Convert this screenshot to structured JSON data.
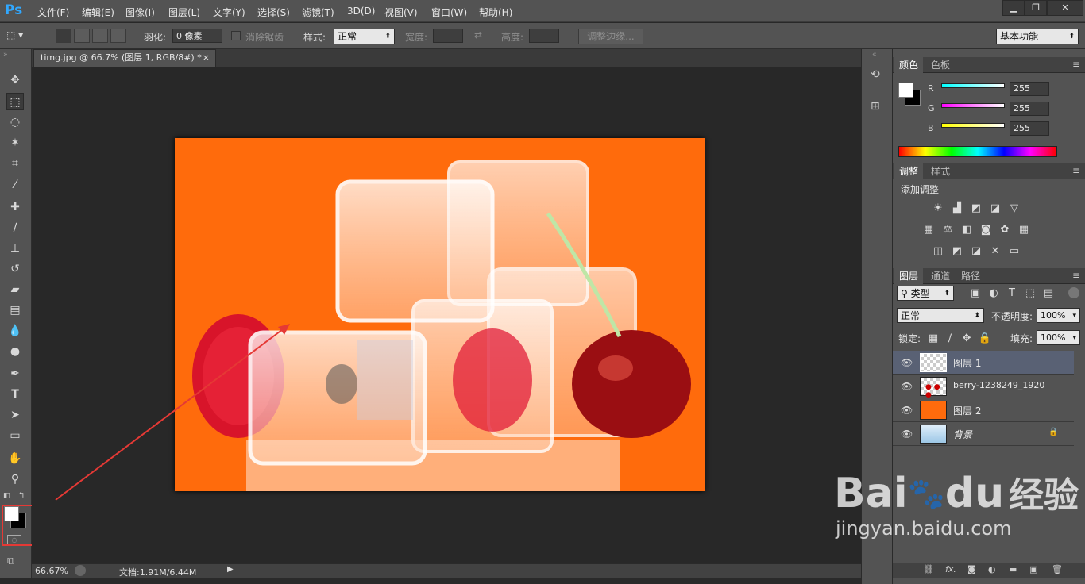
{
  "app": {
    "logo": "Ps"
  },
  "menu": [
    "文件(F)",
    "编辑(E)",
    "图像(I)",
    "图层(L)",
    "文字(Y)",
    "选择(S)",
    "滤镜(T)",
    "3D(D)",
    "视图(V)",
    "窗口(W)",
    "帮助(H)"
  ],
  "window_buttons": {
    "minimize": "▁",
    "restore": "❐",
    "close": "✕"
  },
  "options": {
    "feather_label": "羽化:",
    "feather_value": "0 像素",
    "antialias_label": "消除锯齿",
    "style_label": "样式:",
    "style_value": "正常",
    "width_label": "宽度:",
    "height_label": "高度:",
    "refine_edge": "调整边缘...",
    "workspace": "基本功能"
  },
  "document": {
    "tab_title": "timg.jpg @ 66.7% (图层 1, RGB/8#) *",
    "close": "×"
  },
  "status": {
    "zoom": "66.67%",
    "doc_info": "文档:1.91M/6.44M"
  },
  "color_panel": {
    "tabs": [
      "颜色",
      "色板"
    ],
    "channels": [
      {
        "label": "R",
        "value": "255",
        "color": "#00ffff"
      },
      {
        "label": "G",
        "value": "255",
        "color": "#ff00ff"
      },
      {
        "label": "B",
        "value": "255",
        "color": "#ffff00"
      }
    ]
  },
  "adjust_panel": {
    "tabs": [
      "调整",
      "样式"
    ],
    "title": "添加调整"
  },
  "layers_panel": {
    "tabs": [
      "图层",
      "通道",
      "路径"
    ],
    "filter_label": "类型",
    "blend_mode": "正常",
    "opacity_label": "不透明度:",
    "opacity_value": "100%",
    "lock_label": "锁定:",
    "fill_label": "填充:",
    "fill_value": "100%",
    "layers": [
      {
        "name": "图层 1",
        "selected": true
      },
      {
        "name": "berry-1238249_1920",
        "selected": false
      },
      {
        "name": "图层 2",
        "selected": false
      },
      {
        "name": "背景",
        "selected": false,
        "locked": true
      }
    ]
  },
  "watermark": {
    "brand": "Bai",
    "brand2": "du",
    "cn": "经验",
    "url": "jingyan.baidu.com"
  },
  "colors": {
    "image_bg": "#ff6b0c",
    "highlight": "#e53935",
    "ui_panel": "#535353"
  }
}
